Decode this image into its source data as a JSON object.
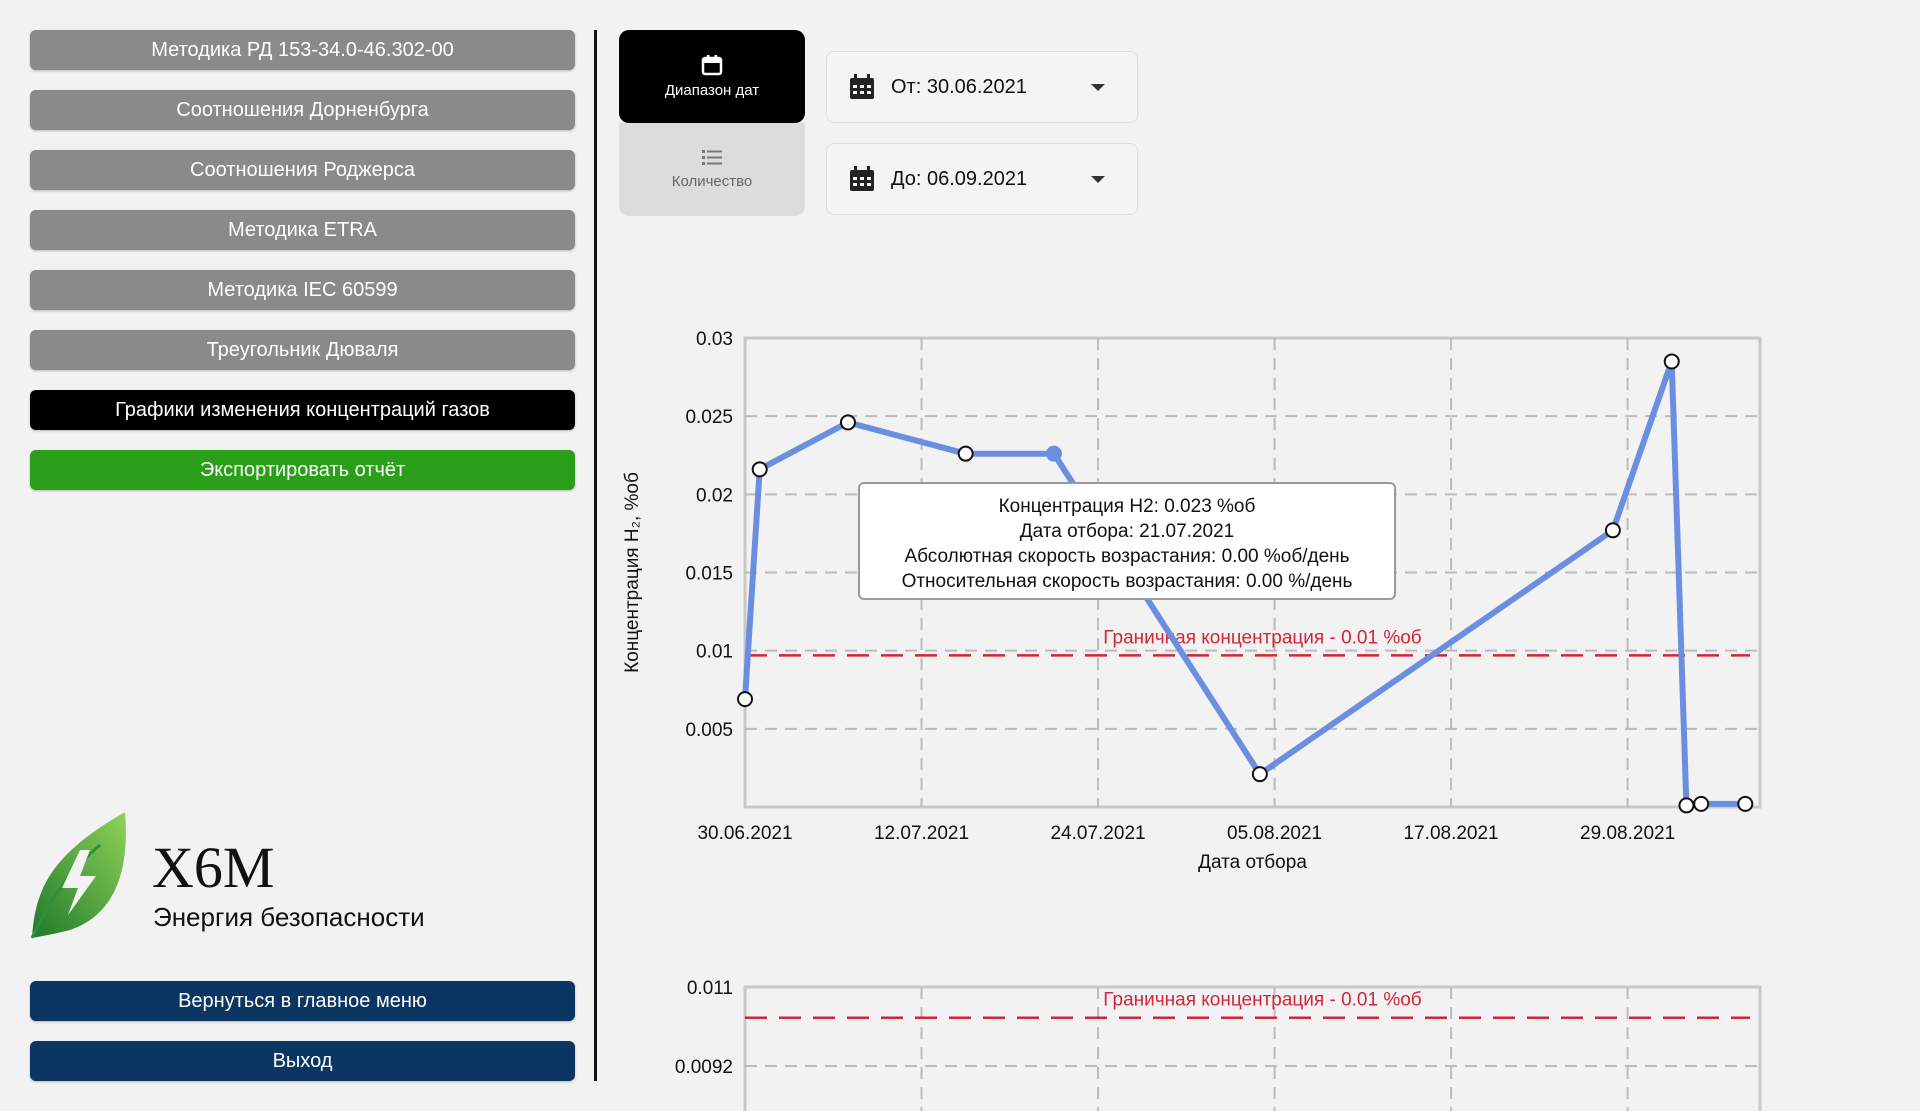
{
  "sidebar": {
    "items": [
      {
        "label": "Методика РД 153-34.0-46.302-00"
      },
      {
        "label": "Соотношения Дорненбурга"
      },
      {
        "label": "Соотношения Роджерса"
      },
      {
        "label": "Методика ETRA"
      },
      {
        "label": "Методика IEC 60599"
      },
      {
        "label": "Треугольник Дюваля"
      },
      {
        "label": "Графики изменения концентраций газов"
      }
    ],
    "export_label": "Экспортировать отчёт",
    "back_label": "Вернуться в главное меню",
    "exit_label": "Выход"
  },
  "logo": {
    "title": "Х6М",
    "subtitle": "Энергия безопасности"
  },
  "mode": {
    "date_range_label": "Диапазон дат",
    "count_label": "Количество"
  },
  "date_from": "От: 30.06.2021",
  "date_to": "До: 06.09.2021",
  "colors": {
    "accent_green": "#2aa01a",
    "navy": "#0b3563",
    "series": "#6b8fe0",
    "threshold": "#d0253a"
  },
  "tooltip": {
    "line1": "Концентрация H2: 0.023 %об",
    "line2": "Дата отбора: 21.07.2021",
    "line3": "Абсолютная скорость возрастания: 0.00 %об/день",
    "line4": "Относительная скорость возрастания: 0.00 %/день"
  },
  "chart_data": [
    {
      "type": "line",
      "title": "",
      "xlabel": "Дата отбора",
      "ylabel": "Концентрация H₂, %об",
      "x_ticks": [
        "30.06.2021",
        "12.07.2021",
        "24.07.2021",
        "05.08.2021",
        "17.08.2021",
        "29.08.2021"
      ],
      "y_ticks": [
        "0.005",
        "0.01",
        "0.015",
        "0.02",
        "0.025",
        "0.03"
      ],
      "xlim": [
        "30.06.2021",
        "07.09.2021"
      ],
      "ylim": [
        0,
        0.03
      ],
      "grid": true,
      "threshold": {
        "value": 0.0097,
        "label": "Граничная концентрация - 0.01 %об"
      },
      "series": [
        {
          "points": [
            {
              "x": "30.06.2021",
              "y": 0.0069
            },
            {
              "x": "01.07.2021",
              "y": 0.0216
            },
            {
              "x": "07.07.2021",
              "y": 0.0246
            },
            {
              "x": "15.07.2021",
              "y": 0.0226
            },
            {
              "x": "21.07.2021",
              "y": 0.0226
            },
            {
              "x": "04.08.2021",
              "y": 0.0021
            },
            {
              "x": "28.08.2021",
              "y": 0.0177
            },
            {
              "x": "01.09.2021",
              "y": 0.0285
            },
            {
              "x": "02.09.2021",
              "y": 0.0001
            },
            {
              "x": "03.09.2021",
              "y": 0.0002
            },
            {
              "x": "06.09.2021",
              "y": 0.0002
            }
          ]
        }
      ]
    },
    {
      "type": "line",
      "y_ticks": [
        "0.0092",
        "0.011"
      ],
      "threshold": {
        "value": 0.0103,
        "label": "Граничная концентрация - 0.01 %об"
      },
      "grid": true
    }
  ]
}
